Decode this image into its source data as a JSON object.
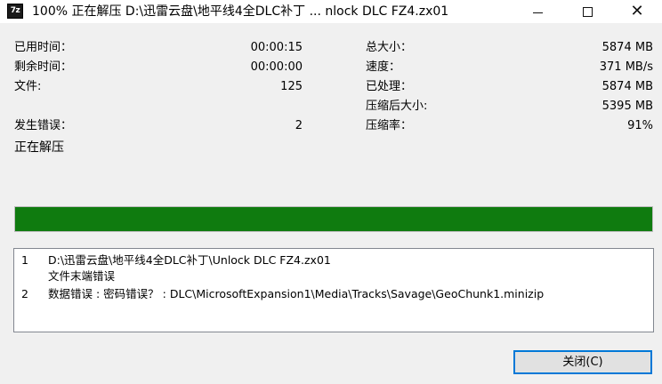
{
  "titlebar": {
    "app_icon": "7z",
    "title": "100% 正在解压 D:\\迅雷云盘\\地平线4全DLC补丁 ... nlock DLC FZ4.zx01",
    "minimize_icon": "minimize-icon",
    "maximize_icon": "maximize-icon",
    "close_icon": "close-icon"
  },
  "stats_left": {
    "elapsed_label": "已用时间：",
    "elapsed_value": "00:00:15",
    "remaining_label": "剩余时间：",
    "remaining_value": "00:00:00",
    "files_label": "文件:",
    "files_value": "125",
    "errors_label": "发生错误：",
    "errors_value": "2",
    "status": "正在解压"
  },
  "stats_right": {
    "total_size_label": "总大小：",
    "total_size_value": "5874 MB",
    "speed_label": "速度：",
    "speed_value": "371 MB/s",
    "processed_label": "已处理：",
    "processed_value": "5874 MB",
    "compressed_label": "压缩后大小:",
    "compressed_value": "5395 MB",
    "ratio_label": "压缩率：",
    "ratio_value": "91%"
  },
  "progress": {
    "fraction": 1.0,
    "color": "#0f7b0f"
  },
  "log": [
    {
      "num": "1",
      "text": "D:\\迅雷云盘\\地平线4全DLC补丁\\Unlock DLC FZ4.zx01"
    },
    {
      "num": "",
      "text": "文件末端错误"
    },
    {
      "num": "2",
      "text": "数据错误 : 密码错误？ : DLC\\MicrosoftExpansion1\\Media\\Tracks\\Savage\\GeoChunk1.minizip"
    }
  ],
  "buttons": {
    "close_label": "关闭(C)"
  }
}
